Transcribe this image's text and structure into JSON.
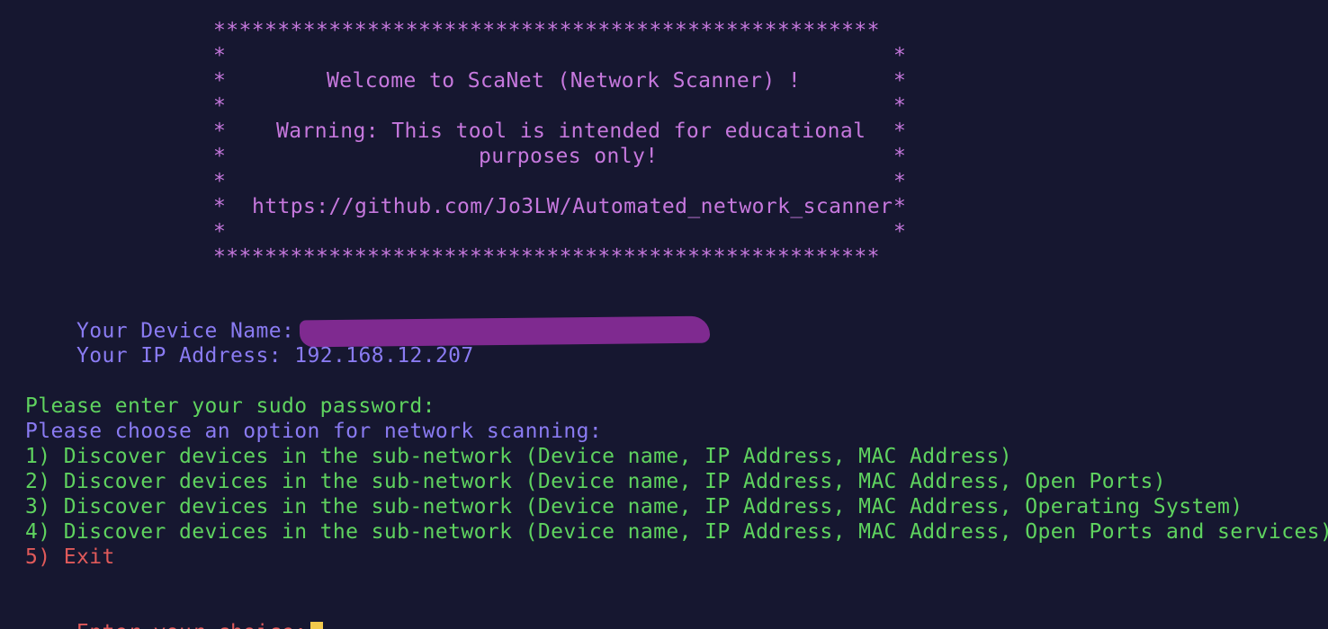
{
  "banner": {
    "border": "****************************************************",
    "star": "*",
    "welcome": "Welcome to ScaNet (Network Scanner) !",
    "warning_line1": "Warning: This tool is intended for educational",
    "warning_line2": "purposes only!",
    "url": "https://github.com/Jo3LW/Automated_network_scanner"
  },
  "device": {
    "name_label": "Your Device Name:",
    "ip_label": "Your IP Address:",
    "ip_value": "192.168.12.207"
  },
  "prompts": {
    "sudo": "Please enter your sudo password:",
    "choose": "Please choose an option for network scanning:"
  },
  "options": [
    "1) Discover devices in the sub-network (Device name, IP Address, MAC Address)",
    "2) Discover devices in the sub-network (Device name, IP Address, MAC Address, Open Ports)",
    "3) Discover devices in the sub-network (Device name, IP Address, MAC Address, Operating System)",
    "4) Discover devices in the sub-network (Device name, IP Address, MAC Address, Open Ports and services)",
    "5) Exit"
  ],
  "input": {
    "label": "Enter your choice:"
  },
  "colors": {
    "background": "#161730",
    "banner_stars": "#c678dd",
    "purple_text": "#8a7bf2",
    "yellow_text": "#f2c94c",
    "green_text": "#5fd35f",
    "red_text": "#e05a5a",
    "redaction": "#7f2a90"
  }
}
